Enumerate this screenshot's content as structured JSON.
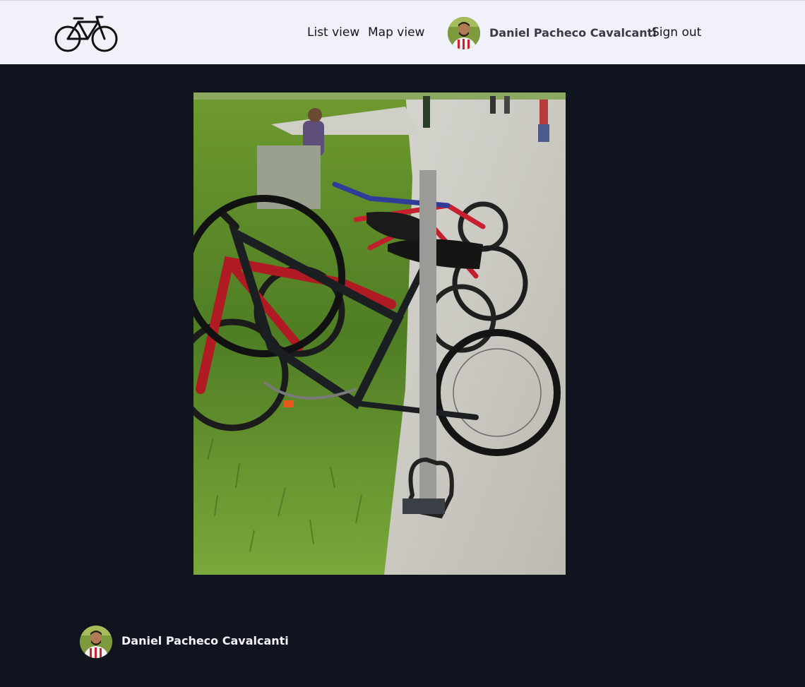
{
  "header": {
    "logo_icon": "bicycle-icon",
    "nav": {
      "list_view": "List view",
      "map_view": "Map view",
      "sign_out": "Sign out"
    },
    "user": {
      "name": "Daniel Pacheco Cavalcanti",
      "avatar_alt": "Daniel Pacheco Cavalcanti"
    }
  },
  "main": {
    "photo_alt": "Bicycles locked to a rack beside a path and grass"
  },
  "footer": {
    "user": {
      "name": "Daniel Pacheco Cavalcanti",
      "avatar_alt": "Daniel Pacheco Cavalcanti"
    }
  },
  "colors": {
    "header_bg": "#f1f1f9",
    "page_bg": "#0f141f",
    "header_text": "#15151c",
    "footer_text": "#f2f2f7"
  }
}
